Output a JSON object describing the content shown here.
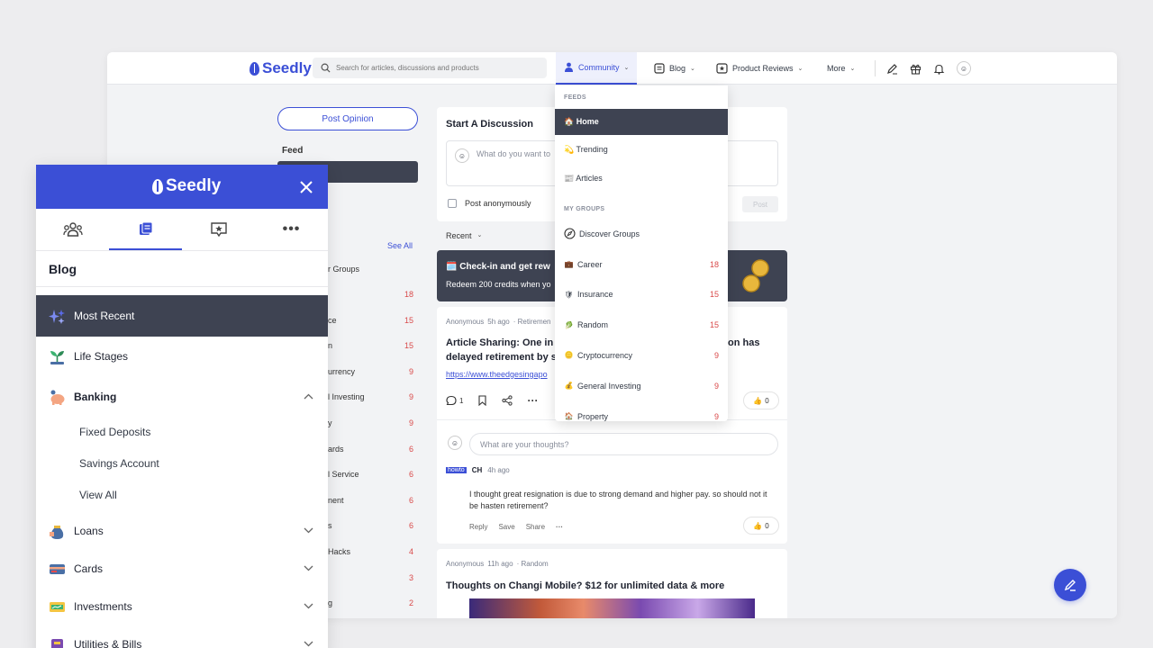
{
  "brand": "Seedly",
  "nav": {
    "search_placeholder": "Search for articles, discussions and products",
    "community": "Community",
    "blog": "Blog",
    "product_reviews": "Product Reviews",
    "more": "More"
  },
  "left": {
    "post_opinion": "Post Opinion",
    "feed": "Feed",
    "see_all": "See All",
    "groups_partial": "r Groups",
    "groups": [
      {
        "label": "",
        "count": "18"
      },
      {
        "label": "ce",
        "count": "15"
      },
      {
        "label": "n",
        "count": "15"
      },
      {
        "label": "urrency",
        "count": "9"
      },
      {
        "label": "l Investing",
        "count": "9"
      },
      {
        "label": "y",
        "count": "9"
      },
      {
        "label": "ards",
        "count": "6"
      },
      {
        "label": "l Service",
        "count": "6"
      },
      {
        "label": "nent",
        "count": "6"
      },
      {
        "label": "s",
        "count": "6"
      },
      {
        "label": "Hacks",
        "count": "4"
      },
      {
        "label": "",
        "count": "3"
      },
      {
        "label": "g",
        "count": "2"
      }
    ]
  },
  "discussion": {
    "title": "Start A Discussion",
    "placeholder": "What do you want to",
    "anon": "Post anonymously",
    "post": "Post"
  },
  "sort": "Recent",
  "promo": {
    "title": "🗓️ Check-in and get rew",
    "subtitle": "Redeem 200 credits when yo"
  },
  "post1": {
    "author": "Anonymous",
    "time": "5h ago",
    "tag": "· Retiremen",
    "title_a": "Article Sharing: One in f",
    "title_b": "on has",
    "title_c": "delayed retirement by s",
    "link": "https://www.theedgesingapo",
    "comments": "1",
    "likes": "0",
    "reply_placeholder": "What are your thoughts?",
    "comment_badge": "howto",
    "comment_author": "CH",
    "comment_time": "4h ago",
    "comment_text": "I thought great resignation is due to strong demand and higher pay. so should not it be hasten retirement?",
    "reply": "Reply",
    "save": "Save",
    "share": "Share",
    "comment_likes": "0"
  },
  "post2": {
    "author": "Anonymous",
    "time": "11h ago",
    "tag": "· Random",
    "title": "Thoughts on Changi Mobile? $12 for unlimited data & more"
  },
  "dropdown": {
    "feeds_header": "FEEDS",
    "feeds": [
      {
        "label": "🏠 Home"
      },
      {
        "label": "💫 Trending"
      },
      {
        "label": "📰 Articles"
      }
    ],
    "groups_header": "MY GROUPS",
    "discover": "Discover Groups",
    "groups": [
      {
        "label": "Career",
        "count": "18",
        "icon": "💼"
      },
      {
        "label": "Insurance",
        "count": "15",
        "icon": "🛡"
      },
      {
        "label": "Random",
        "count": "15",
        "icon": "🥬"
      },
      {
        "label": "Cryptocurrency",
        "count": "9",
        "icon": "🪙"
      },
      {
        "label": "General Investing",
        "count": "9",
        "icon": "💰"
      },
      {
        "label": "Property",
        "count": "9",
        "icon": "🏠"
      }
    ]
  },
  "mobile": {
    "title": "Blog",
    "items": [
      {
        "label": "Most Recent"
      },
      {
        "label": "Life Stages"
      },
      {
        "label": "Banking"
      },
      {
        "label": "Loans"
      },
      {
        "label": "Cards"
      },
      {
        "label": "Investments"
      },
      {
        "label": "Utilities & Bills"
      }
    ],
    "banking_sub": [
      "Fixed Deposits",
      "Savings Account",
      "View All"
    ]
  },
  "colors": {
    "brand": "#3b4fd6",
    "dark": "#3e4352",
    "count": "#d94a4a"
  }
}
